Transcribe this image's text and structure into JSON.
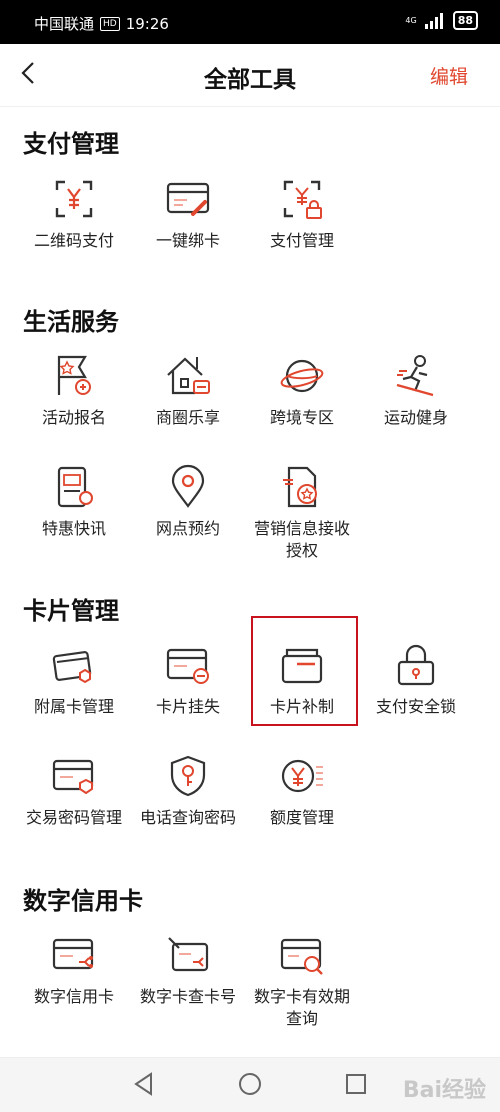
{
  "status_bar": {
    "carrier": "中国联通",
    "hd_badge": "HD",
    "time": "19:26",
    "network": "4G",
    "battery": "88"
  },
  "header": {
    "title": "全部工具",
    "edit_label": "编辑",
    "back_icon": "back-arrow-icon"
  },
  "sections": {
    "payment": {
      "title": "支付管理",
      "items": {
        "qr_pay": "二维码支付",
        "bind_card": "一键绑卡",
        "pay_manage": "支付管理"
      }
    },
    "life": {
      "title": "生活服务",
      "items": {
        "activity": "活动报名",
        "mall": "商圈乐享",
        "cross_border": "跨境专区",
        "sports": "运动健身",
        "news": "特惠快讯",
        "branch": "网点预约",
        "marketing": "营销信息接收授权"
      }
    },
    "card": {
      "title": "卡片管理",
      "items": {
        "sub_card": "附属卡管理",
        "report_loss": "卡片挂失",
        "reissue": "卡片补制",
        "pay_lock": "支付安全锁",
        "trade_pwd": "交易密码管理",
        "phone_pwd": "电话查询密码",
        "limit": "额度管理"
      }
    },
    "digital": {
      "title": "数字信用卡",
      "items": {
        "digital_card": "数字信用卡",
        "card_no": "数字卡查卡号",
        "expiry": "数字卡有效期查询"
      }
    }
  },
  "watermark": "Bai经验",
  "colors": {
    "accent": "#e0472e",
    "highlight": "#c8121e",
    "icon_line": "#333333"
  }
}
